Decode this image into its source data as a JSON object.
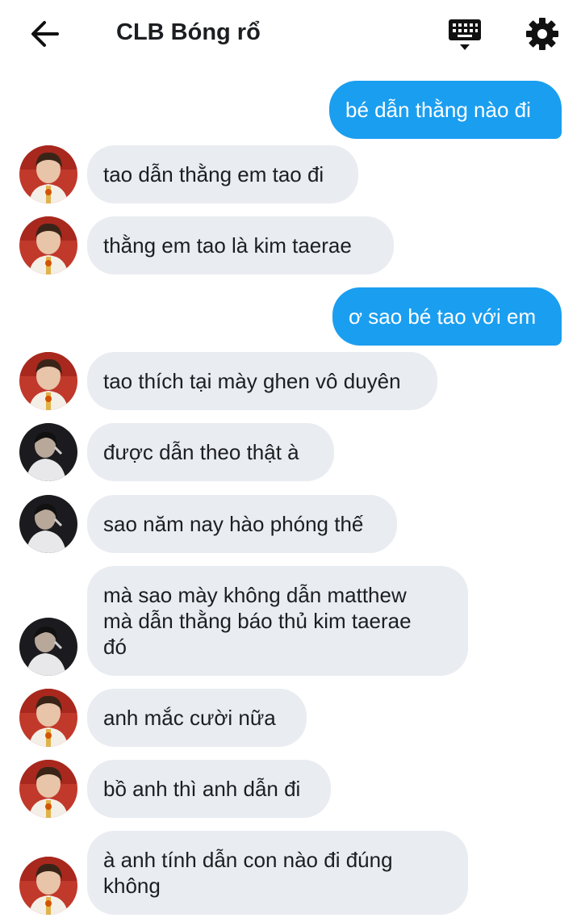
{
  "header": {
    "title": "CLB Bóng rổ",
    "back_icon": "arrow-left-icon",
    "keyboard_icon": "keyboard-icon",
    "settings_icon": "gear-icon"
  },
  "colors": {
    "outgoing_bubble": "#1a9ef0",
    "incoming_bubble": "#e9ecf0",
    "text": "#1c1e21"
  },
  "messages": [
    {
      "direction": "out",
      "text": "bé dẫn thằng nào đi"
    },
    {
      "direction": "in",
      "sender": "red-avatar",
      "text": "tao dẫn thằng em tao đi"
    },
    {
      "direction": "in",
      "sender": "red-avatar",
      "text": "thằng em tao là kim taerae"
    },
    {
      "direction": "out",
      "text": "ơ sao bé tao với em"
    },
    {
      "direction": "in",
      "sender": "red-avatar",
      "text": "tao thích tại mày ghen vô duyên"
    },
    {
      "direction": "in",
      "sender": "dark-avatar",
      "text": "được dẫn theo thật à"
    },
    {
      "direction": "in",
      "sender": "dark-avatar",
      "text": "sao năm nay hào phóng thế"
    },
    {
      "direction": "in",
      "sender": "dark-avatar",
      "text": "mà sao mày không dẫn matthew\nmà dẫn thằng báo thủ kim taerae\nđó"
    },
    {
      "direction": "in",
      "sender": "red-avatar",
      "text": "anh mắc cười nữa"
    },
    {
      "direction": "in",
      "sender": "red-avatar",
      "text": "bồ anh thì anh dẫn đi"
    },
    {
      "direction": "in",
      "sender": "red-avatar",
      "text": "à anh tính dẫn con nào đi đúng\nkhông"
    }
  ]
}
